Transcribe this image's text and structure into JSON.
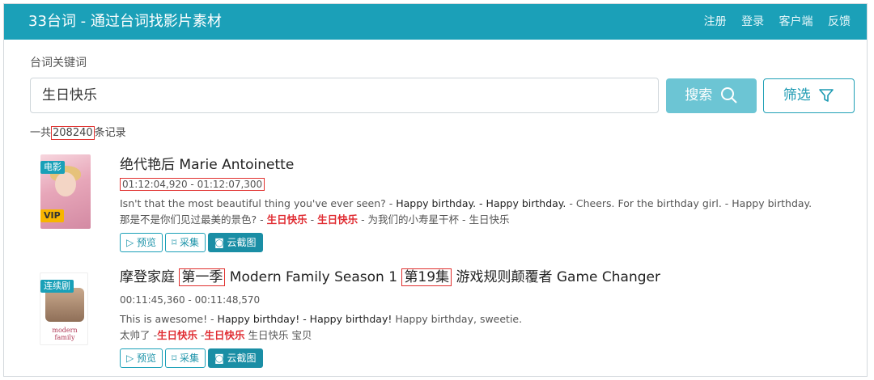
{
  "header": {
    "title": "33台词 - 通过台词找影片素材",
    "nav": [
      "注册",
      "登录",
      "客户端",
      "反馈"
    ]
  },
  "search": {
    "label": "台词关键词",
    "value": "生日快乐",
    "search_button": "搜索",
    "filter_button": "筛选"
  },
  "results_count": {
    "prefix": "一共",
    "count": "208240",
    "suffix": "条记录"
  },
  "results": [
    {
      "badge": "电影",
      "vip": "VIP",
      "title": "绝代艳后 Marie Antoinette",
      "timecode": "01:12:04,920 - 01:12:07,300",
      "en_line": {
        "before": "Isn't that the most beautiful thing you've ever seen?  - ",
        "current": "Happy birthday. - Happy birthday.",
        "after": " - Cheers. For the birthday girl. - Happy birthday."
      },
      "cn_line": {
        "before": "那是不是你们见过最美的景色?   - ",
        "hl1": "生日快乐",
        "mid": " - ",
        "hl2": "生日快乐",
        "after": " - 为我们的小寿星干杯 - 生日快乐"
      },
      "actions": [
        "预览",
        "采集",
        "云截图"
      ]
    },
    {
      "badge": "连续剧",
      "poster_text": "modern family",
      "title_pre": "摩登家庭 ",
      "title_season": "第一季",
      "title_mid": " Modern Family Season 1 ",
      "title_episode": "第19集",
      "title_post": " 游戏规则颠覆者 Game Changer",
      "timecode": "00:11:45,360 - 00:11:48,570",
      "en_line": {
        "before": "This is awesome!  - ",
        "current": "Happy birthday! - Happy birthday!",
        "after": " Happy birthday, sweetie."
      },
      "cn_line": {
        "before": "太帅了  -",
        "hl1": "生日快乐",
        "mid": " -",
        "hl2": "生日快乐",
        "after": " 生日快乐 宝贝"
      },
      "actions": [
        "预览",
        "采集",
        "云截图"
      ]
    }
  ]
}
